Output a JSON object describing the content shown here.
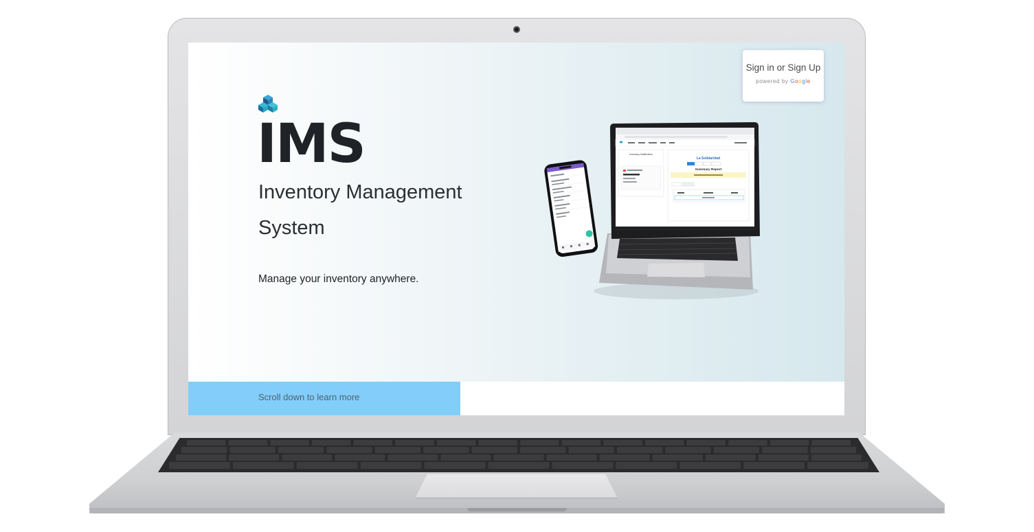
{
  "auth": {
    "signin_label": "Sign in or Sign Up",
    "powered_prefix": "powered by",
    "google_letters": [
      "G",
      "o",
      "o",
      "g",
      "l",
      "e"
    ]
  },
  "hero": {
    "title": "IMS",
    "subtitle": "Inventory Management System",
    "tagline": "Manage your inventory anywhere."
  },
  "banner": {
    "scroll_text": "Scroll down to learn more"
  },
  "mockup": {
    "store_name": "La Solidaridad",
    "panel_title": "Inventory Notification",
    "report_title": "Summary Report"
  },
  "colors": {
    "banner": "#82cdf9",
    "title": "#1f2226",
    "logo_dark": "#1e5c8f",
    "logo_light": "#2aa8c9"
  },
  "icons": {
    "logo": "cube-stack-icon",
    "webcam": "webcam-icon"
  }
}
